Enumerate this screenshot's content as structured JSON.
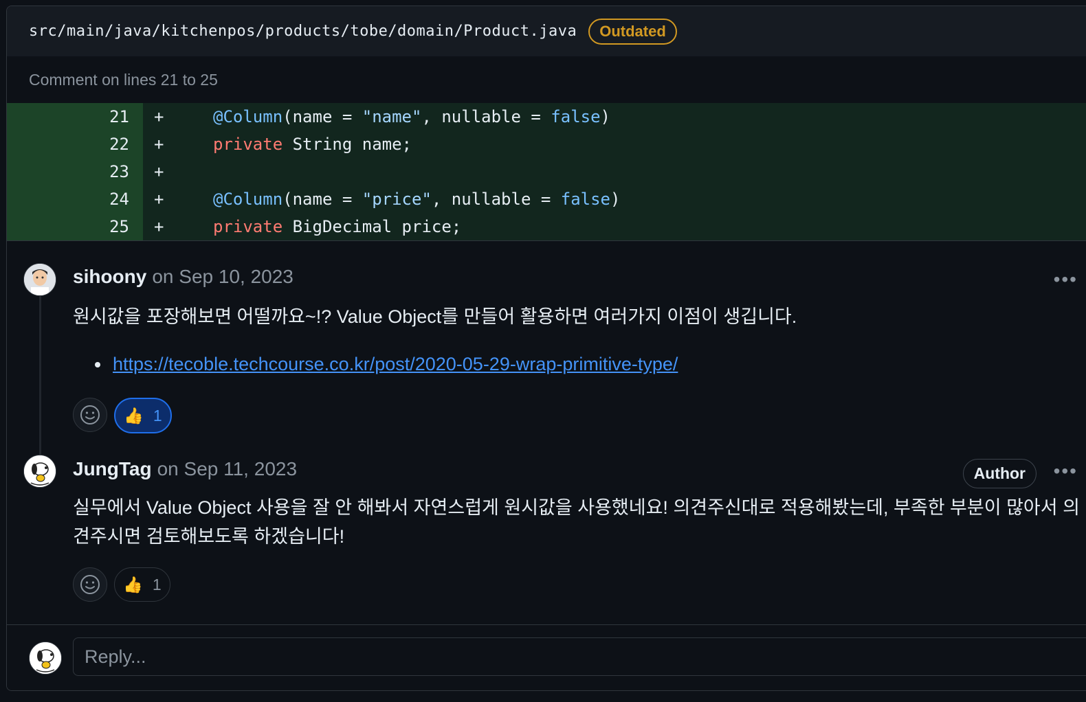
{
  "file": {
    "path": "src/main/java/kitchenpos/products/tobe/domain/Product.java",
    "status_badge": "Outdated"
  },
  "comment_range": "Comment on lines 21 to 25",
  "diff": {
    "lines": [
      {
        "number": "21",
        "marker": "+",
        "tokens": [
          {
            "t": "@Column",
            "c": "ann"
          },
          {
            "t": "(name = ",
            "c": ""
          },
          {
            "t": "\"name\"",
            "c": "str"
          },
          {
            "t": ", nullable = ",
            "c": ""
          },
          {
            "t": "false",
            "c": "bool"
          },
          {
            "t": ")",
            "c": ""
          }
        ]
      },
      {
        "number": "22",
        "marker": "+",
        "tokens": [
          {
            "t": "private",
            "c": "kw"
          },
          {
            "t": " String name;",
            "c": ""
          }
        ]
      },
      {
        "number": "23",
        "marker": "+",
        "tokens": []
      },
      {
        "number": "24",
        "marker": "+",
        "tokens": [
          {
            "t": "@Column",
            "c": "ann"
          },
          {
            "t": "(name = ",
            "c": ""
          },
          {
            "t": "\"price\"",
            "c": "str"
          },
          {
            "t": ", nullable = ",
            "c": ""
          },
          {
            "t": "false",
            "c": "bool"
          },
          {
            "t": ")",
            "c": ""
          }
        ]
      },
      {
        "number": "25",
        "marker": "+",
        "tokens": [
          {
            "t": "private",
            "c": "kw"
          },
          {
            "t": " BigDecimal price;",
            "c": ""
          }
        ]
      }
    ]
  },
  "comments": [
    {
      "author": "sihoony",
      "date": "on Sep 10, 2023",
      "text": "원시값을 포장해보면 어떨까요~!? Value Object를 만들어 활용하면 여러가지 이점이 생깁니다.",
      "link": "https://tecoble.techcourse.co.kr/post/2020-05-29-wrap-primitive-type/",
      "reaction_count": "1",
      "menu": "..."
    },
    {
      "author": "JungTag",
      "date": "on Sep 11, 2023",
      "badge": "Author",
      "text_line1": "실무에서 Value Object 사용을 잘 안 해봐서 자연스럽게 원시값을 사용했네요! 의견주신대로 적용해봤는데, 부족한 부분이 많아서 의",
      "text_line2": "견주시면 검토해보도록 하겠습니다!",
      "reaction_count": "1",
      "menu": "..."
    }
  ],
  "reply": {
    "placeholder": "Reply..."
  },
  "colors": {
    "background": "#0d1117",
    "added_line": "#12261e",
    "added_gutter": "#1c4428",
    "outdated": "#d29922",
    "link": "#4493f8"
  }
}
